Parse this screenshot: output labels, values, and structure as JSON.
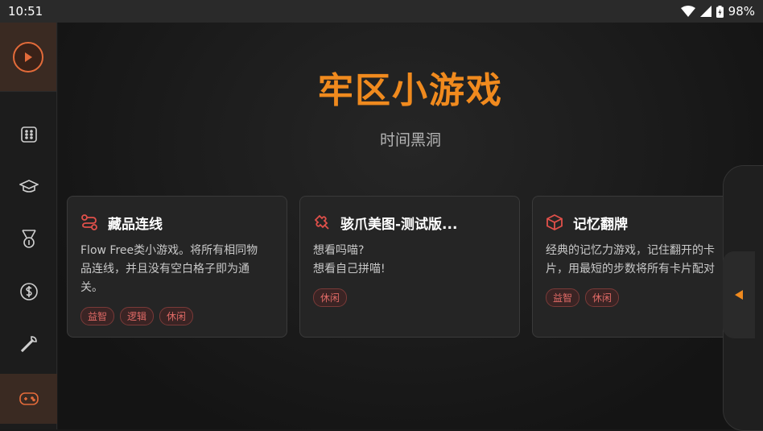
{
  "status": {
    "time": "10:51",
    "battery": "98%"
  },
  "page": {
    "title": "牢区小游戏",
    "subtitle": "时间黑洞"
  },
  "sidebar": {
    "items": [
      {
        "icon": "dice-icon"
      },
      {
        "icon": "graduation-cap-icon"
      },
      {
        "icon": "medal-icon"
      },
      {
        "icon": "dollar-coin-icon"
      },
      {
        "icon": "wrench-icon"
      },
      {
        "icon": "gamepad-icon",
        "active": true
      }
    ]
  },
  "cards": [
    {
      "title": "藏品连线",
      "icon": "route-icon",
      "desc": [
        "Flow Free类小游戏。将所有相同物",
        "品连线，并且没有空白格子即为通",
        "关。"
      ],
      "tags": [
        "益智",
        "逻辑",
        "休闲"
      ]
    },
    {
      "title": "骇爪美图-测试版...",
      "icon": "puzzle-icon",
      "desc": [
        "想看吗喵?",
        "想看自己拼喵!"
      ],
      "tags": [
        "休闲"
      ]
    },
    {
      "title": "记忆翻牌",
      "icon": "cube-icon",
      "desc": [
        "经典的记忆力游戏，记住翻开的卡",
        "片，用最短的步数将所有卡片配对"
      ],
      "tags": [
        "益智",
        "休闲"
      ]
    }
  ],
  "colors": {
    "accent": "#f08a1e",
    "tag_text": "#e06a66",
    "icon_red": "#e0504a"
  }
}
